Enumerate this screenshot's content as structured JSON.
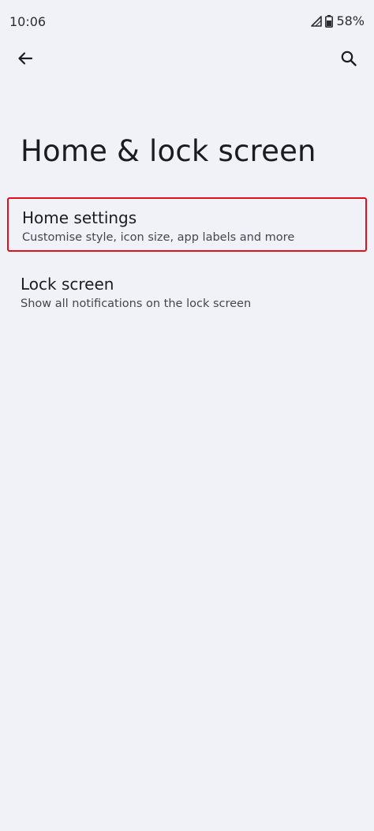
{
  "status_bar": {
    "time": "10:06",
    "battery": "58%",
    "icons": [
      "signal-icon",
      "battery-icon"
    ]
  },
  "app_bar": {
    "back_icon": "arrow-back-icon",
    "search_icon": "search-icon"
  },
  "page": {
    "title": "Home & lock screen"
  },
  "settings": {
    "items": [
      {
        "title": "Home settings",
        "subtitle": "Customise style, icon size, app labels and more",
        "highlighted": true
      },
      {
        "title": "Lock screen",
        "subtitle": "Show all notifications on the lock screen",
        "highlighted": false
      }
    ]
  },
  "colors": {
    "background": "#f1f2f8",
    "text_primary": "#1b1c22",
    "text_secondary": "#43454f",
    "highlight_border": "#e2101b"
  }
}
